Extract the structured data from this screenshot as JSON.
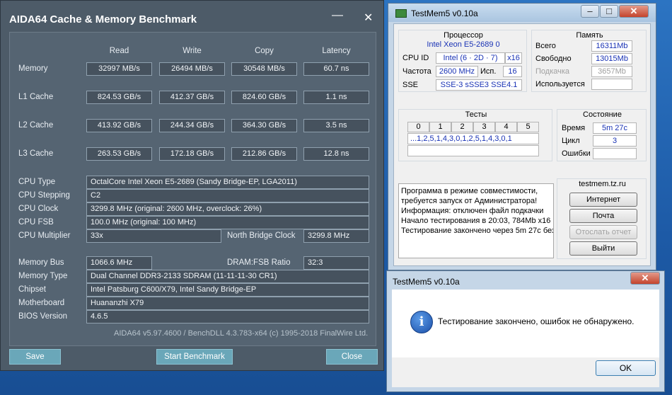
{
  "aida": {
    "title": "AIDA64 Cache & Memory Benchmark",
    "min": "—",
    "close": "✕",
    "headers": {
      "read": "Read",
      "write": "Write",
      "copy": "Copy",
      "latency": "Latency"
    },
    "rows": [
      {
        "label": "Memory",
        "read": "32997 MB/s",
        "write": "26494 MB/s",
        "copy": "30548 MB/s",
        "latency": "60.7 ns"
      },
      {
        "label": "L1 Cache",
        "read": "824.53 GB/s",
        "write": "412.37 GB/s",
        "copy": "824.60 GB/s",
        "latency": "1.1 ns"
      },
      {
        "label": "L2 Cache",
        "read": "413.92 GB/s",
        "write": "244.34 GB/s",
        "copy": "364.30 GB/s",
        "latency": "3.5 ns"
      },
      {
        "label": "L3 Cache",
        "read": "263.53 GB/s",
        "write": "172.18 GB/s",
        "copy": "212.86 GB/s",
        "latency": "12.8 ns"
      }
    ],
    "cpu": {
      "type_label": "CPU Type",
      "type": "OctalCore Intel Xeon E5-2689  (Sandy Bridge-EP, LGA2011)",
      "stepping_label": "CPU Stepping",
      "stepping": "C2",
      "clock_label": "CPU Clock",
      "clock": "3299.8 MHz  (original: 2600 MHz, overclock: 26%)",
      "fsb_label": "CPU FSB",
      "fsb": "100.0 MHz  (original: 100 MHz)",
      "mult_label": "CPU Multiplier",
      "mult": "33x",
      "nb_label": "North Bridge Clock",
      "nb": "3299.8 MHz"
    },
    "mem": {
      "bus_label": "Memory Bus",
      "bus": "1066.6 MHz",
      "ratio_label": "DRAM:FSB Ratio",
      "ratio": "32:3",
      "type_label": "Memory Type",
      "type": "Dual Channel DDR3-2133 SDRAM  (11-11-11-30 CR1)",
      "chipset_label": "Chipset",
      "chipset": "Intel Patsburg C600/X79, Intel Sandy Bridge-EP",
      "mb_label": "Motherboard",
      "mb": "Huananzhi X79",
      "bios_label": "BIOS Version",
      "bios": "4.6.5"
    },
    "copyright": "AIDA64 v5.97.4600 / BenchDLL 4.3.783-x64  (c) 1995-2018 FinalWire Ltd.",
    "buttons": {
      "save": "Save",
      "start": "Start Benchmark",
      "close": "Close"
    }
  },
  "tm": {
    "title": "TestMem5 v0.10a",
    "cpu_group": "Процессор",
    "cpu_id_label": "CPU ID",
    "cpu_id": "Intel  (6 · 2D · 7)",
    "cpu_id_x": "x16",
    "cpu_name": "Intel Xeon  E5-2689 0",
    "freq_label": "Частота",
    "freq": "2600 MHz",
    "threads_label": "Исп.",
    "threads": "16",
    "sse_label": "SSE",
    "sse": "SSE-3 sSSE3 SSE4.1",
    "mem_group": "Память",
    "total_label": "Всего",
    "total": "16311Mb",
    "free_label": "Свободно",
    "free": "13015Mb",
    "swap_label": "Подкачка",
    "swap": "3657Mb",
    "used_label": "Используется",
    "used": "",
    "tests_group": "Тесты",
    "test_nums": [
      "0",
      "1",
      "2",
      "3",
      "4",
      "5"
    ],
    "test_seq": "...1,2,5,1,4,3,0,1,2,5,1,4,3,0,1",
    "state_group": "Состояние",
    "time_label": "Время",
    "time": "5m 27c",
    "cycle_label": "Цикл",
    "cycle": "3",
    "errors_label": "Ошибки",
    "errors": "",
    "log": [
      "Программа в режиме совместимости,",
      "требуется запуск от Администратора!",
      "Информация: отключен файл подкачки",
      "Начало тестирования в 20:03, 784Mb x16",
      "Тестирование закончено через 5m 27c без"
    ],
    "site": "testmem.tz.ru",
    "btn_internet": "Интернет",
    "btn_mail": "Почта",
    "btn_report": "Отослать отчет",
    "btn_exit": "Выйти"
  },
  "dlg": {
    "title": "TestMem5 v0.10a",
    "message": "Тестирование закончено, ошибок не обнаружено.",
    "ok": "OK",
    "close": "✕",
    "info": "i"
  }
}
